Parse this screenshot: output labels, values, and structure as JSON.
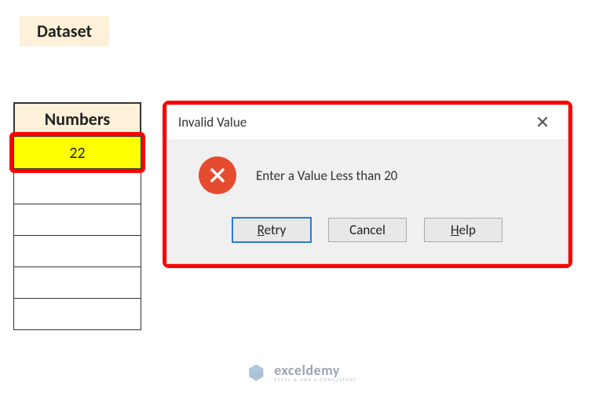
{
  "title": "Dataset",
  "table": {
    "header": "Numbers",
    "first_value": "22",
    "row_count": 5
  },
  "dialog": {
    "title": "Invalid Value",
    "message": "Enter a Value Less than 20",
    "buttons": {
      "retry": "Retry",
      "cancel": "Cancel",
      "help": "Help"
    }
  },
  "watermark": {
    "name": "exceldemy",
    "sub": "EXCEL & VBA • CONSULTANT"
  }
}
